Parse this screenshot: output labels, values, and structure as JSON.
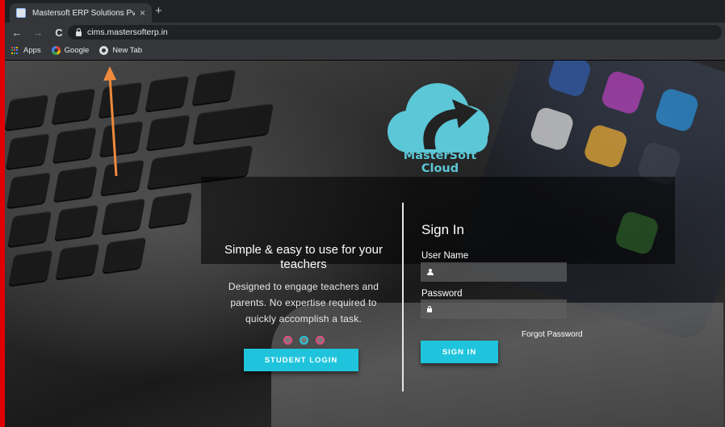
{
  "browser": {
    "tab_title": "Mastersoft ERP Solutions Pvt.Ltd",
    "tab_close": "×",
    "new_tab": "+",
    "back": "←",
    "forward": "→",
    "reload": "C",
    "url": "cims.mastersofterp.in",
    "bookmarks": [
      {
        "label": "Apps",
        "icon": "apps-grid-icon"
      },
      {
        "label": "Google",
        "icon": "google-icon"
      },
      {
        "label": "New Tab",
        "icon": "chrome-icon"
      }
    ]
  },
  "brand": {
    "name": "MasterSoft Cloud",
    "logo_color": "#5cc7d6"
  },
  "left_panel": {
    "tagline": "Simple & easy to use for your teachers",
    "description": "Designed to engage teachers and parents. No expertise required to quickly accomplish a task.",
    "carousel_dots": 3,
    "active_dot": 2,
    "student_login_label": "STUDENT LOGIN"
  },
  "signin": {
    "title": "Sign In",
    "username_label": "User Name",
    "username_value": "",
    "password_label": "Password",
    "password_value": "",
    "forgot_label": "Forgot Password",
    "button_label": "SIGN IN"
  },
  "colors": {
    "accent": "#1fc4dc",
    "dot_border": "#e44d7e",
    "annotation_arrow": "#f08a3c"
  }
}
